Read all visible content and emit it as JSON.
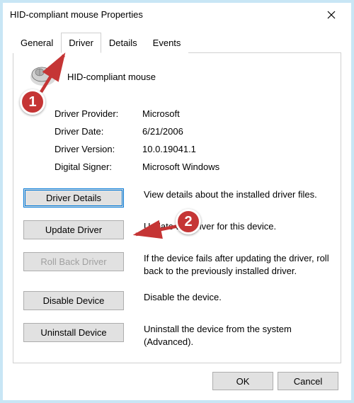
{
  "window": {
    "title": "HID-compliant mouse Properties"
  },
  "tabs": {
    "general": "General",
    "driver": "Driver",
    "details": "Details",
    "events": "Events"
  },
  "device": {
    "name": "HID-compliant mouse"
  },
  "info": {
    "provider_label": "Driver Provider:",
    "provider": "Microsoft",
    "date_label": "Driver Date:",
    "date": "6/21/2006",
    "version_label": "Driver Version:",
    "version": "10.0.19041.1",
    "signer_label": "Digital Signer:",
    "signer": "Microsoft Windows"
  },
  "buttons": {
    "details": "Driver Details",
    "details_desc": "View details about the installed driver files.",
    "update": "Update Driver",
    "update_desc": "Update the driver for this device.",
    "rollback": "Roll Back Driver",
    "rollback_desc": "If the device fails after updating the driver, roll back to the previously installed driver.",
    "disable": "Disable Device",
    "disable_desc": "Disable the device.",
    "uninstall": "Uninstall Device",
    "uninstall_desc": "Uninstall the device from the system (Advanced)."
  },
  "footer": {
    "ok": "OK",
    "cancel": "Cancel"
  },
  "annotations": {
    "one": "1",
    "two": "2"
  }
}
